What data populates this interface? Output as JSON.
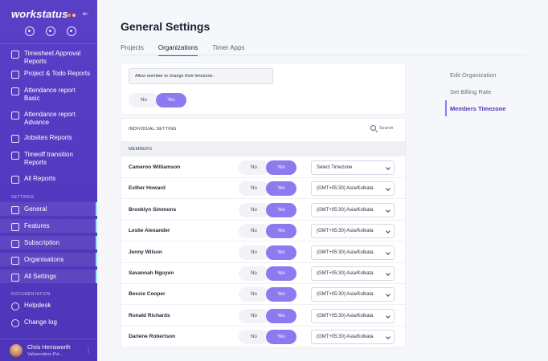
{
  "sidebar": {
    "logo": "workstatus",
    "logo_dot_colors": [
      "#ff7a59",
      "#ffc94d"
    ],
    "top_icons": [
      "clock-icon",
      "timer-icon",
      "bell-icon"
    ],
    "items": [
      {
        "label": "Timesheet Approval Reports",
        "icon": "report-icon"
      },
      {
        "label": "Project & Todo Reports",
        "icon": "report-icon"
      },
      {
        "label": "Attendance report Basic",
        "icon": "report-icon"
      },
      {
        "label": "Attendance report Advance",
        "icon": "report-icon"
      },
      {
        "label": "Jobsites Reports",
        "icon": "report-icon"
      },
      {
        "label": "Timeoff transition Reports",
        "icon": "report-icon"
      },
      {
        "label": "All Reports",
        "icon": "report-icon"
      }
    ],
    "settings_label": "SETTINGS",
    "settings_items": [
      {
        "label": "General",
        "icon": "menu-icon"
      },
      {
        "label": "Features",
        "icon": "grid-icon"
      },
      {
        "label": "Subscription",
        "icon": "card-icon"
      },
      {
        "label": "Organisations",
        "icon": "org-icon"
      },
      {
        "label": "All Settings",
        "icon": "gear-icon"
      }
    ],
    "documentation_label": "DOCUMENTATION",
    "doc_items": [
      {
        "label": "Helpdesk",
        "icon": "chat-icon"
      },
      {
        "label": "Change log",
        "icon": "refresh-icon"
      }
    ],
    "user": {
      "name": "Chris Hemsworth",
      "org": "Valuecoders Pvt..."
    }
  },
  "main": {
    "title": "General Settings",
    "tabs": [
      {
        "label": "Projects"
      },
      {
        "label": "Organizations"
      },
      {
        "label": "Timer Apps"
      }
    ],
    "active_tab": "Organizations",
    "notice": "Allow member to change their timezone.",
    "toggle_no": "No",
    "toggle_yes": "Yes",
    "individual_setting": "INDIVIDUAL SETTING",
    "search_label": "Search",
    "members_label": "MEMBERS",
    "members": [
      {
        "name": "Cameron Williamson",
        "timezone": "Select Timezone"
      },
      {
        "name": "Esther Howard",
        "timezone": "(GMT+05:30) Asia/Kolkata"
      },
      {
        "name": "Brooklyn Simmons",
        "timezone": "(GMT+05:30) Asia/Kolkata"
      },
      {
        "name": "Leslie Alexander",
        "timezone": "(GMT+05:30) Asia/Kolkata"
      },
      {
        "name": "Jenny Wilson",
        "timezone": "(GMT+05:30) Asia/Kolkata"
      },
      {
        "name": "Savannah Nguyen",
        "timezone": "(GMT+05:30) Asia/Kolkata"
      },
      {
        "name": "Bessie Cooper",
        "timezone": "(GMT+05:30) Asia/Kolkata"
      },
      {
        "name": "Ronald Richards",
        "timezone": "(GMT+05:30) Asia/Kolkata"
      },
      {
        "name": "Darlene Robertson",
        "timezone": "(GMT+05:30) Asia/Kolkata"
      }
    ]
  },
  "right_panel": {
    "items": [
      {
        "label": "Edit Organization"
      },
      {
        "label": "Set Billing Rate"
      },
      {
        "label": "Members Timezone"
      }
    ],
    "active": "Members Timezone"
  },
  "colors": {
    "sidebar": "#5a3fc7",
    "accent": "#8b7af0",
    "indicator": "#9be3ff"
  }
}
